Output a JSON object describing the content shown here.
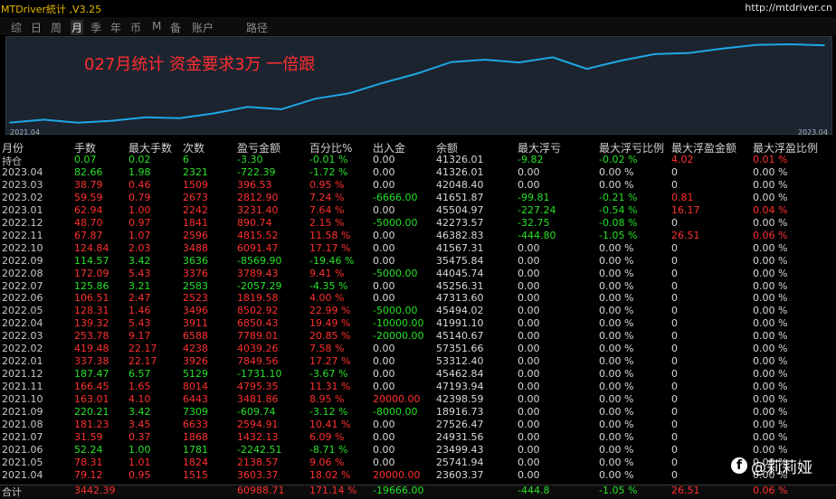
{
  "window": {
    "title": "MTDriver統计 ,V3.25",
    "url": "http://mtdriver.cn"
  },
  "tabs": [
    {
      "label": "综",
      "active": false
    },
    {
      "label": "日",
      "active": false
    },
    {
      "label": "周",
      "active": false
    },
    {
      "label": "月",
      "active": true
    },
    {
      "label": "季",
      "active": false
    },
    {
      "label": "年",
      "active": false
    },
    {
      "label": "币",
      "active": false
    },
    {
      "label": "M",
      "active": false
    },
    {
      "label": "备",
      "active": false
    },
    {
      "label": "账户",
      "active": false
    },
    {
      "label": "路径",
      "active": false
    }
  ],
  "chart": {
    "annotation": "027月统计 资金要求3万 一倍跟",
    "x_start": "2021.04",
    "x_end": "2023.04",
    "line_color": "#1ea8e6"
  },
  "chart_data": {
    "type": "line",
    "title": "027月统计 资金要求3万 一倍跟",
    "categories": [
      "2021.04",
      "2021.05",
      "2021.06",
      "2021.07",
      "2021.08",
      "2021.09",
      "2021.10",
      "2021.11",
      "2021.12",
      "2022.01",
      "2022.02",
      "2022.03",
      "2022.04",
      "2022.05",
      "2022.06",
      "2022.07",
      "2022.08",
      "2022.09",
      "2022.10",
      "2022.11",
      "2022.12",
      "2023.01",
      "2023.02",
      "2023.03",
      "2023.04"
    ],
    "series": [
      {
        "values": [
          23603.37,
          25741.94,
          23499.43,
          24931.56,
          27526.47,
          18916.73,
          42398.59,
          47193.94,
          45462.84,
          53312.4,
          57351.66,
          45140.67,
          41991.1,
          45494.02,
          47313.6,
          45256.31,
          44045.74,
          35475.84,
          41567.31,
          46382.83,
          42273.57,
          45504.97,
          41651.87,
          42048.4,
          41326.01
        ]
      }
    ]
  },
  "table": {
    "headers": [
      "月份",
      "手数",
      "最大手数",
      "次数",
      "盈亏金额",
      "百分比%",
      "出入金",
      "余额",
      "最大浮亏",
      "最大浮亏比例",
      "最大浮盈金额",
      "最大浮盈比例"
    ],
    "rows": [
      {
        "c": [
          "持仓",
          "0.07",
          "0.02",
          "6",
          "-3.30",
          "-0.01 %",
          "0.00",
          "41326.01",
          "-9.82",
          "-0.02 %",
          "4.02",
          "0.01 %"
        ],
        "tone": "neg"
      },
      {
        "c": [
          "2023.04",
          "82.66",
          "1.98",
          "2321",
          "-722.39",
          "-1.72 %",
          "0.00",
          "41326.01",
          "0.00",
          "0.00 %",
          "0",
          "0.00 %"
        ],
        "tone": "neg"
      },
      {
        "c": [
          "2023.03",
          "38.79",
          "0.46",
          "1509",
          "396.53",
          "0.95 %",
          "0.00",
          "42048.40",
          "0.00",
          "0.00 %",
          "0",
          "0.00 %"
        ],
        "tone": "pos"
      },
      {
        "c": [
          "2023.02",
          "59.59",
          "0.79",
          "2673",
          "2812.90",
          "7.24 %",
          "-6666.00",
          "41651.87",
          "-99.81",
          "-0.21 %",
          "0.81",
          "0.00 %"
        ],
        "tone": "pos"
      },
      {
        "c": [
          "2023.01",
          "62.94",
          "1.00",
          "2242",
          "3231.40",
          "7.64 %",
          "0.00",
          "45504.97",
          "-227.24",
          "-0.54 %",
          "16.17",
          "0.04 %"
        ],
        "tone": "pos"
      },
      {
        "c": [
          "2022.12",
          "48.70",
          "0.97",
          "1841",
          "890.74",
          "2.15 %",
          "-5000.00",
          "42273.57",
          "-32.75",
          "-0.08 %",
          "0",
          "0.00 %"
        ],
        "tone": "pos"
      },
      {
        "c": [
          "2022.11",
          "67.87",
          "1.07",
          "2596",
          "4815.52",
          "11.58 %",
          "0.00",
          "46382.83",
          "-444.80",
          "-1.05 %",
          "26.51",
          "0.06 %"
        ],
        "tone": "pos"
      },
      {
        "c": [
          "2022.10",
          "124.84",
          "2.03",
          "3488",
          "6091.47",
          "17.17 %",
          "0.00",
          "41567.31",
          "0.00",
          "0.00 %",
          "0",
          "0.00 %"
        ],
        "tone": "pos"
      },
      {
        "c": [
          "2022.09",
          "114.57",
          "3.42",
          "3636",
          "-8569.90",
          "-19.46 %",
          "0.00",
          "35475.84",
          "0.00",
          "0.00 %",
          "0",
          "0.00 %"
        ],
        "tone": "neg"
      },
      {
        "c": [
          "2022.08",
          "172.09",
          "5.43",
          "3376",
          "3789.43",
          "9.41 %",
          "-5000.00",
          "44045.74",
          "0.00",
          "0.00 %",
          "0",
          "0.00 %"
        ],
        "tone": "pos"
      },
      {
        "c": [
          "2022.07",
          "125.86",
          "3.21",
          "2583",
          "-2057.29",
          "-4.35 %",
          "0.00",
          "45256.31",
          "0.00",
          "0.00 %",
          "0",
          "0.00 %"
        ],
        "tone": "neg"
      },
      {
        "c": [
          "2022.06",
          "106.51",
          "2.47",
          "2523",
          "1819.58",
          "4.00 %",
          "0.00",
          "47313.60",
          "0.00",
          "0.00 %",
          "0",
          "0.00 %"
        ],
        "tone": "pos"
      },
      {
        "c": [
          "2022.05",
          "128.31",
          "1.46",
          "3496",
          "8502.92",
          "22.99 %",
          "-5000.00",
          "45494.02",
          "0.00",
          "0.00 %",
          "0",
          "0.00 %"
        ],
        "tone": "pos"
      },
      {
        "c": [
          "2022.04",
          "139.32",
          "5.43",
          "3911",
          "6850.43",
          "19.49 %",
          "-10000.00",
          "41991.10",
          "0.00",
          "0.00 %",
          "0",
          "0.00 %"
        ],
        "tone": "pos"
      },
      {
        "c": [
          "2022.03",
          "253.78",
          "9.17",
          "6588",
          "7789.01",
          "20.85 %",
          "-20000.00",
          "45140.67",
          "0.00",
          "0.00 %",
          "0",
          "0.00 %"
        ],
        "tone": "pos"
      },
      {
        "c": [
          "2022.02",
          "419.48",
          "22.17",
          "4238",
          "4039.26",
          "7.58 %",
          "0.00",
          "57351.66",
          "0.00",
          "0.00 %",
          "0",
          "0.00 %"
        ],
        "tone": "pos"
      },
      {
        "c": [
          "2022.01",
          "337.38",
          "22.17",
          "3926",
          "7849.56",
          "17.27 %",
          "0.00",
          "53312.40",
          "0.00",
          "0.00 %",
          "0",
          "0.00 %"
        ],
        "tone": "pos"
      },
      {
        "c": [
          "2021.12",
          "187.47",
          "6.57",
          "5129",
          "-1731.10",
          "-3.67 %",
          "0.00",
          "45462.84",
          "0.00",
          "0.00 %",
          "0",
          "0.00 %"
        ],
        "tone": "neg"
      },
      {
        "c": [
          "2021.11",
          "166.45",
          "1.65",
          "8014",
          "4795.35",
          "11.31 %",
          "0.00",
          "47193.94",
          "0.00",
          "0.00 %",
          "0",
          "0.00 %"
        ],
        "tone": "pos"
      },
      {
        "c": [
          "2021.10",
          "163.01",
          "4.10",
          "6443",
          "3481.86",
          "8.95 %",
          "20000.00",
          "42398.59",
          "0.00",
          "0.00 %",
          "0",
          "0.00 %"
        ],
        "tone": "pos"
      },
      {
        "c": [
          "2021.09",
          "220.21",
          "3.42",
          "7309",
          "-609.74",
          "-3.12 %",
          "-8000.00",
          "18916.73",
          "0.00",
          "0.00 %",
          "0",
          "0.00 %"
        ],
        "tone": "neg"
      },
      {
        "c": [
          "2021.08",
          "181.23",
          "3.45",
          "6633",
          "2594.91",
          "10.41 %",
          "0.00",
          "27526.47",
          "0.00",
          "0.00 %",
          "0",
          "0.00 %"
        ],
        "tone": "pos"
      },
      {
        "c": [
          "2021.07",
          "31.59",
          "0.37",
          "1868",
          "1432.13",
          "6.09 %",
          "0.00",
          "24931.56",
          "0.00",
          "0.00 %",
          "0",
          "0.00 %"
        ],
        "tone": "pos"
      },
      {
        "c": [
          "2021.06",
          "52.24",
          "1.00",
          "1781",
          "-2242.51",
          "-8.71 %",
          "0.00",
          "23499.43",
          "0.00",
          "0.00 %",
          "0",
          "0.00 %"
        ],
        "tone": "neg"
      },
      {
        "c": [
          "2021.05",
          "78.31",
          "1.01",
          "1824",
          "2138.57",
          "9.06 %",
          "0.00",
          "25741.94",
          "0.00",
          "0.00 %",
          "0",
          "0.00 %"
        ],
        "tone": "pos"
      },
      {
        "c": [
          "2021.04",
          "79.12",
          "0.95",
          "1515",
          "3603.37",
          "18.02 %",
          "20000.00",
          "23603.37",
          "0.00",
          "0.00 %",
          "0",
          "0.00 %"
        ],
        "tone": "pos"
      }
    ],
    "total": {
      "c": [
        "合计",
        "3442.39",
        "",
        "",
        "60988.71",
        "171.14 %",
        "-19666.00",
        "",
        "-444.8",
        "-1.05 %",
        "26.51",
        "0.06 %"
      ]
    }
  },
  "watermark": {
    "badge": "f",
    "text": "@莉莉娅"
  },
  "colors": {
    "profit": "#ff3030",
    "loss": "#28e028",
    "title": "#e8b800"
  }
}
